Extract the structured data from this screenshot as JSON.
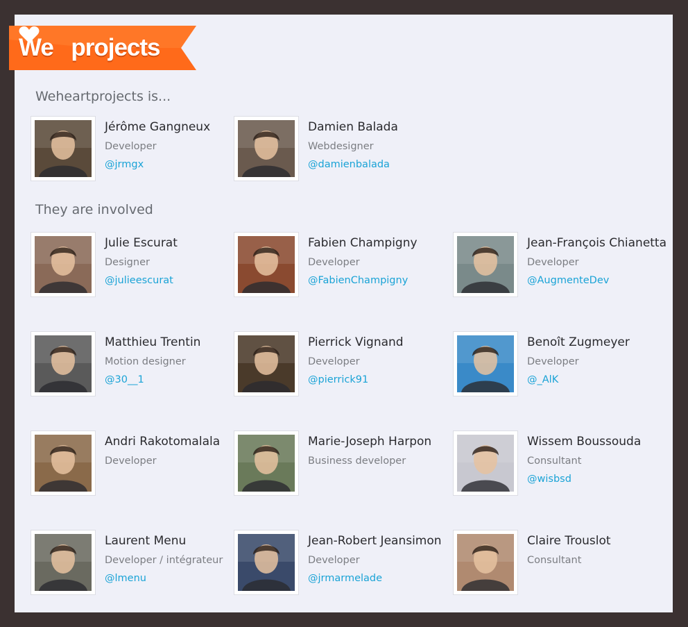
{
  "brand": {
    "word_before": "We",
    "word_after": "projects",
    "icon": "heart-icon",
    "ribbon_color": "#ff6a1a"
  },
  "sections": {
    "team_title": "Weheartprojects is...",
    "involved_title": "They are involved"
  },
  "team": [
    {
      "name": "Jérôme Gangneux",
      "role": "Developer",
      "handle": "@jrmgx",
      "tone": "#5a4a3a"
    },
    {
      "name": "Damien Balada",
      "role": "Webdesigner",
      "handle": "@damienbalada",
      "tone": "#6a5a4e"
    }
  ],
  "involved": [
    {
      "name": "Julie Escurat",
      "role": "Designer",
      "handle": "@julieescurat",
      "tone": "#8a6a58"
    },
    {
      "name": "Fabien Champigny",
      "role": "Developer",
      "handle": "@FabienChampigny",
      "tone": "#8a4a30"
    },
    {
      "name": "Jean-François Chianetta",
      "role": "Developer",
      "handle": "@AugmenteDev",
      "tone": "#7a8a8a"
    },
    {
      "name": "Matthieu Trentin",
      "role": "Motion designer",
      "handle": "@30__1",
      "tone": "#5a5a5a"
    },
    {
      "name": "Pierrick Vignand",
      "role": "Developer",
      "handle": "@pierrick91",
      "tone": "#4a3a2a"
    },
    {
      "name": "Benoît Zugmeyer",
      "role": "Developer",
      "handle": "@_AlK",
      "tone": "#3a8ac8"
    },
    {
      "name": "Andri Rakotomalala",
      "role": "Developer",
      "handle": "",
      "tone": "#8a6a4a"
    },
    {
      "name": "Marie-Joseph Harpon",
      "role": "Business developer",
      "handle": "",
      "tone": "#6a7a5a"
    },
    {
      "name": "Wissem Boussouda",
      "role": "Consultant",
      "handle": "@wisbsd",
      "tone": "#c8c8d0"
    },
    {
      "name": "Laurent Menu",
      "role": "Developer / intégrateur",
      "handle": "@lmenu",
      "tone": "#6a6a60"
    },
    {
      "name": "Jean-Robert Jeansimon",
      "role": "Developer",
      "handle": "@jrmarmelade",
      "tone": "#3a4a6a"
    },
    {
      "name": "Claire Trouslot",
      "role": "Consultant",
      "handle": "",
      "tone": "#b08a70"
    }
  ]
}
